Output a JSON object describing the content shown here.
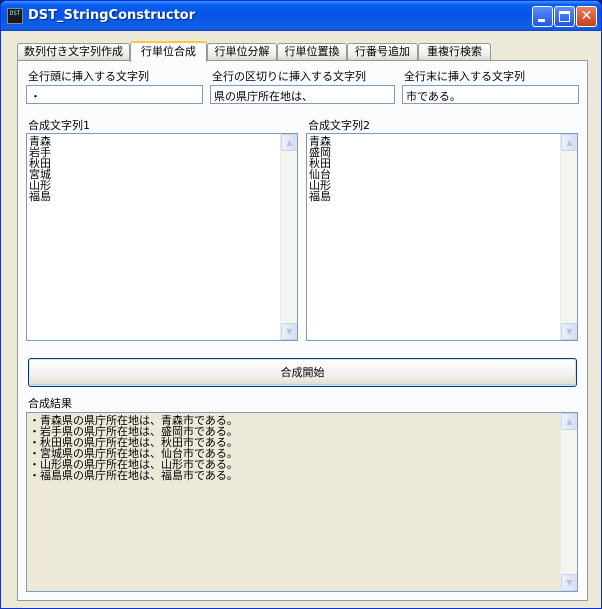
{
  "window": {
    "title": "DST_StringConstructor",
    "icon_text": "DST"
  },
  "tabs": [
    {
      "label": "数列付き文字列作成"
    },
    {
      "label": "行単位合成"
    },
    {
      "label": "行単位分解"
    },
    {
      "label": "行単位置換"
    },
    {
      "label": "行番号追加"
    },
    {
      "label": "重複行検索"
    }
  ],
  "active_tab": "行単位合成",
  "fields": {
    "prefix": {
      "label": "全行頭に挿入する文字列",
      "value": "・"
    },
    "separator": {
      "label": "全行の区切りに挿入する文字列",
      "value": "県の県庁所在地は、"
    },
    "suffix": {
      "label": "全行末に挿入する文字列",
      "value": "市である。"
    }
  },
  "list1": {
    "label": "合成文字列1",
    "lines": [
      "青森",
      "岩手",
      "秋田",
      "宮城",
      "山形",
      "福島"
    ]
  },
  "list2": {
    "label": "合成文字列2",
    "lines": [
      "青森",
      "盛岡",
      "秋田",
      "仙台",
      "山形",
      "福島"
    ]
  },
  "start_button": {
    "label": "合成開始"
  },
  "result": {
    "label": "合成結果",
    "lines": [
      "・青森県の県庁所在地は、青森市である。",
      "・岩手県の県庁所在地は、盛岡市である。",
      "・秋田県の県庁所在地は、秋田市である。",
      "・宮城県の県庁所在地は、仙台市である。",
      "・山形県の県庁所在地は、山形市である。",
      "・福島県の県庁所在地は、福島市である。"
    ]
  },
  "icons": {
    "scroll_up": "scroll-up-arrow-icon",
    "scroll_down": "scroll-down-arrow-icon",
    "close": "close-icon"
  }
}
